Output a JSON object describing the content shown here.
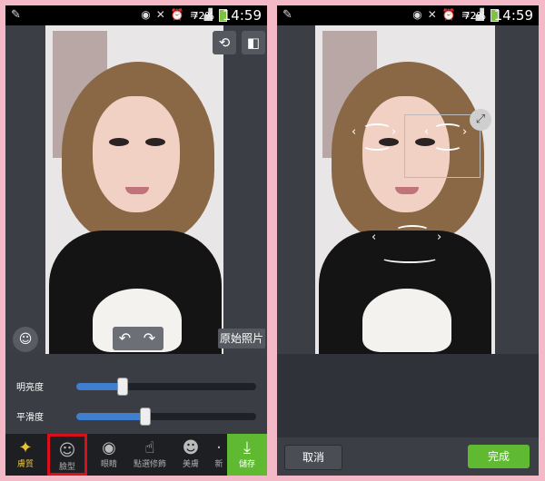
{
  "status_bar": {
    "battery": "72%",
    "time": "14:59"
  },
  "left_screen": {
    "original_photo_label": "原始照片",
    "sliders": [
      {
        "label": "明亮度",
        "value": 0.25
      },
      {
        "label": "平滑度",
        "value": 0.38
      }
    ],
    "tabs": [
      {
        "label": "膚質",
        "icon": "magic-wand-icon",
        "active": true
      },
      {
        "label": "臉型",
        "icon": "face-icon",
        "selected": true
      },
      {
        "label": "眼睛",
        "icon": "eye-icon"
      },
      {
        "label": "點選修飾",
        "icon": "tap-icon"
      },
      {
        "label": "美膚",
        "icon": "person-plus-icon"
      },
      {
        "label": "新",
        "icon": "more-icon"
      }
    ],
    "save_label": "儲存"
  },
  "right_screen": {
    "cancel_label": "取消",
    "done_label": "完成"
  }
}
